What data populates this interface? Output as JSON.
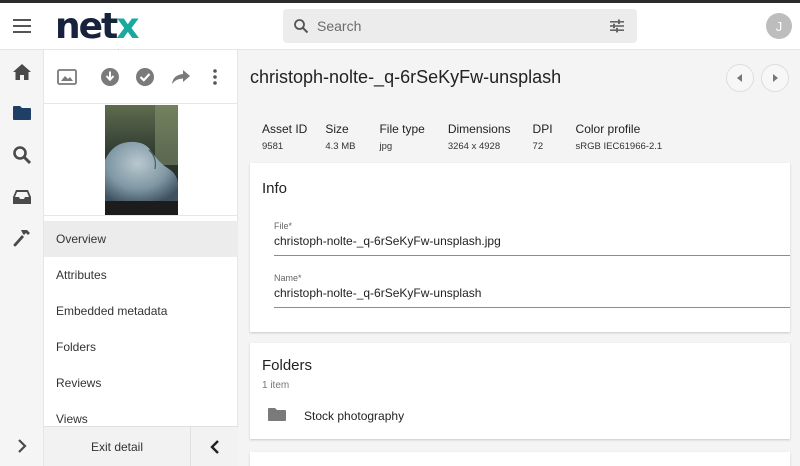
{
  "header": {
    "logo_main": "net",
    "logo_accent": "x",
    "search": {
      "placeholder": "Search",
      "value": ""
    },
    "avatar_initial": "J"
  },
  "rail": {
    "icons": [
      "menu-icon",
      "home-icon",
      "folder-icon",
      "search-icon",
      "inbox-icon",
      "hammer-icon",
      "chevron-right-icon"
    ]
  },
  "panel": {
    "toolbar_icons": [
      "image-icon",
      "download-icon",
      "check-icon",
      "share-icon",
      "more-vertical-icon"
    ],
    "nav": [
      {
        "label": "Overview",
        "active": true
      },
      {
        "label": "Attributes",
        "active": false
      },
      {
        "label": "Embedded metadata",
        "active": false
      },
      {
        "label": "Folders",
        "active": false
      },
      {
        "label": "Reviews",
        "active": false
      },
      {
        "label": "Views",
        "active": false
      }
    ],
    "exit_label": "Exit detail"
  },
  "asset": {
    "title": "christoph-nolte-_q-6rSeKyFw-unsplash",
    "properties": [
      {
        "label": "Asset ID",
        "value": "9581"
      },
      {
        "label": "Size",
        "value": "4.3 MB"
      },
      {
        "label": "File type",
        "value": "jpg"
      },
      {
        "label": "Dimensions",
        "value": "3264 x 4928"
      },
      {
        "label": "DPI",
        "value": "72"
      },
      {
        "label": "Color profile",
        "value": "sRGB IEC61966-2.1"
      }
    ]
  },
  "info": {
    "title": "Info",
    "file_label": "File*",
    "file_value": "christoph-nolte-_q-6rSeKyFw-unsplash.jpg",
    "name_label": "Name*",
    "name_value": "christoph-nolte-_q-6rSeKyFw-unsplash"
  },
  "folders": {
    "title": "Folders",
    "count": "1 item",
    "items": [
      {
        "name": "Stock photography"
      }
    ]
  },
  "colors": {
    "accent": "#1aa99f",
    "logo_dark": "#17233c",
    "background": "#f4f4f4"
  }
}
